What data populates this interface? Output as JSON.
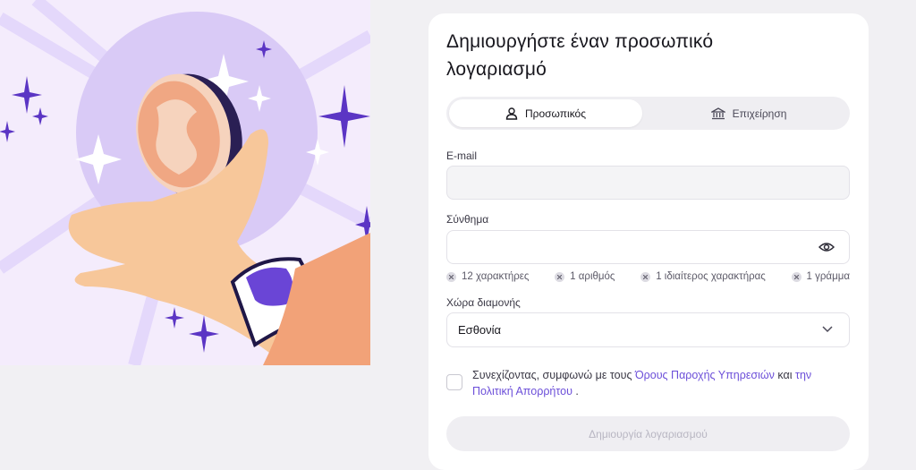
{
  "title": "Δημιουργήστε έναν προσωπικό λογαριασμό",
  "account_type": {
    "personal_label": "Προσωπικός",
    "business_label": "Επιχείρηση"
  },
  "email": {
    "label": "E-mail",
    "value": "",
    "placeholder": ""
  },
  "password": {
    "label": "Σύνθημα",
    "value": "",
    "placeholder": ""
  },
  "requirements": [
    "12 χαρακτήρες",
    "1 αριθμός",
    "1 ιδιαίτερος χαρακτήρας",
    "1 γράμμα"
  ],
  "country": {
    "label": "Χώρα διαμονής",
    "value": "Εσθονία"
  },
  "terms": {
    "prefix": "Συνεχίζοντας, συμφωνώ με τους",
    "terms_link": "Όρους Παροχής Υπηρεσιών",
    "middle": "και",
    "privacy_link": "την Πολιτική Απορρήτου",
    "suffix": "."
  },
  "submit_label": "Δημιουργία λογαριασμού",
  "colors": {
    "accent": "#6c4fd9",
    "illustration_bg": "#f4ecfc",
    "circle": "#d8c8f6"
  }
}
